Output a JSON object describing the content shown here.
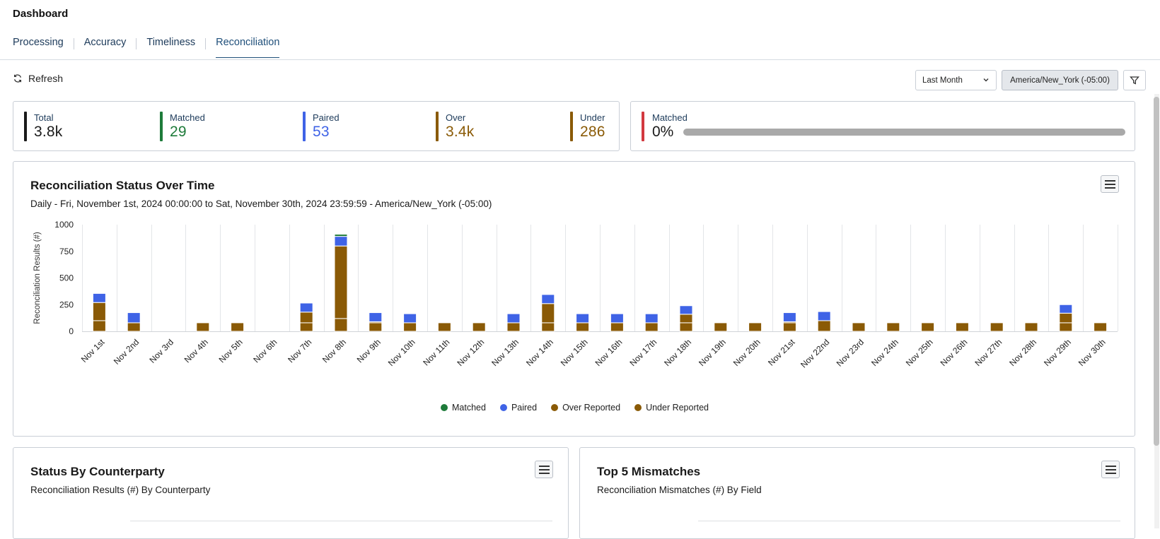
{
  "header": {
    "title": "Dashboard"
  },
  "tabs": [
    {
      "label": "Processing",
      "active": false
    },
    {
      "label": "Accuracy",
      "active": false
    },
    {
      "label": "Timeliness",
      "active": false
    },
    {
      "label": "Reconciliation",
      "active": true
    }
  ],
  "toolbar": {
    "refresh_label": "Refresh",
    "range_select": "Last Month",
    "timezone": "America/New_York (-05:00)"
  },
  "kpis": [
    {
      "label": "Total",
      "value": "3.8k",
      "color": "#1a1a1a"
    },
    {
      "label": "Matched",
      "value": "29",
      "color": "#1e7b3a"
    },
    {
      "label": "Paired",
      "value": "53",
      "color": "#3f63e6"
    },
    {
      "label": "Over",
      "value": "3.4k",
      "color": "#8a5a06"
    },
    {
      "label": "Under",
      "value": "286",
      "color": "#8a5a06"
    }
  ],
  "matched_card": {
    "label": "Matched",
    "value": "0%",
    "progress_fraction": 0
  },
  "status_chart": {
    "title": "Reconciliation Status Over Time",
    "subtitle": "Daily - Fri, November 1st, 2024 00:00:00 to Sat, November 30th, 2024 23:59:59 - America/New_York (-05:00)"
  },
  "chart_data": {
    "type": "bar",
    "stacked": true,
    "ylabel": "Reconciliation Results (#)",
    "xlabel": "",
    "ylim": [
      0,
      1000
    ],
    "yticks": [
      0,
      250,
      500,
      750,
      1000
    ],
    "grid": true,
    "legend_placement": "bottom",
    "categories": [
      "Nov 1st",
      "Nov 2nd",
      "Nov 3rd",
      "Nov 4th",
      "Nov 5th",
      "Nov 6th",
      "Nov 7th",
      "Nov 8th",
      "Nov 9th",
      "Nov 10th",
      "Nov 11th",
      "Nov 12th",
      "Nov 13th",
      "Nov 14th",
      "Nov 15th",
      "Nov 16th",
      "Nov 17th",
      "Nov 18th",
      "Nov 19th",
      "Nov 20th",
      "Nov 21st",
      "Nov 22nd",
      "Nov 23rd",
      "Nov 24th",
      "Nov 25th",
      "Nov 26th",
      "Nov 27th",
      "Nov 28th",
      "Nov 29th",
      "Nov 30th"
    ],
    "series": [
      {
        "name": "Under Reported",
        "color": "#8a5a06",
        "values": [
          100,
          80,
          0,
          80,
          80,
          0,
          80,
          120,
          80,
          80,
          80,
          80,
          80,
          80,
          80,
          80,
          80,
          80,
          80,
          80,
          80,
          100,
          80,
          80,
          80,
          80,
          80,
          80,
          80,
          80
        ]
      },
      {
        "name": "Over Reported",
        "color": "#8a5a06",
        "values": [
          170,
          0,
          0,
          0,
          0,
          0,
          100,
          680,
          10,
          0,
          0,
          0,
          0,
          180,
          0,
          0,
          0,
          80,
          0,
          0,
          10,
          0,
          0,
          0,
          0,
          0,
          0,
          0,
          90,
          0
        ]
      },
      {
        "name": "Paired",
        "color": "#3f63e6",
        "values": [
          85,
          95,
          0,
          0,
          0,
          0,
          85,
          90,
          85,
          85,
          0,
          0,
          85,
          85,
          85,
          85,
          85,
          80,
          0,
          0,
          85,
          85,
          0,
          0,
          0,
          0,
          0,
          0,
          80,
          0
        ]
      },
      {
        "name": "Matched",
        "color": "#1e7b3a",
        "values": [
          0,
          0,
          0,
          0,
          0,
          0,
          0,
          20,
          0,
          0,
          0,
          0,
          0,
          0,
          0,
          0,
          5,
          0,
          0,
          0,
          0,
          0,
          0,
          0,
          0,
          0,
          0,
          0,
          0,
          0
        ]
      }
    ]
  },
  "legend": [
    {
      "label": "Matched",
      "color": "#1e7b3a"
    },
    {
      "label": "Paired",
      "color": "#3f63e6"
    },
    {
      "label": "Over Reported",
      "color": "#8a5a06"
    },
    {
      "label": "Under Reported",
      "color": "#8a5a06"
    }
  ],
  "counterparty_card": {
    "title": "Status By Counterparty",
    "subtitle": "Reconciliation Results (#) By Counterparty"
  },
  "mismatch_card": {
    "title": "Top 5 Mismatches",
    "subtitle": "Reconciliation Mismatches (#) By Field"
  }
}
